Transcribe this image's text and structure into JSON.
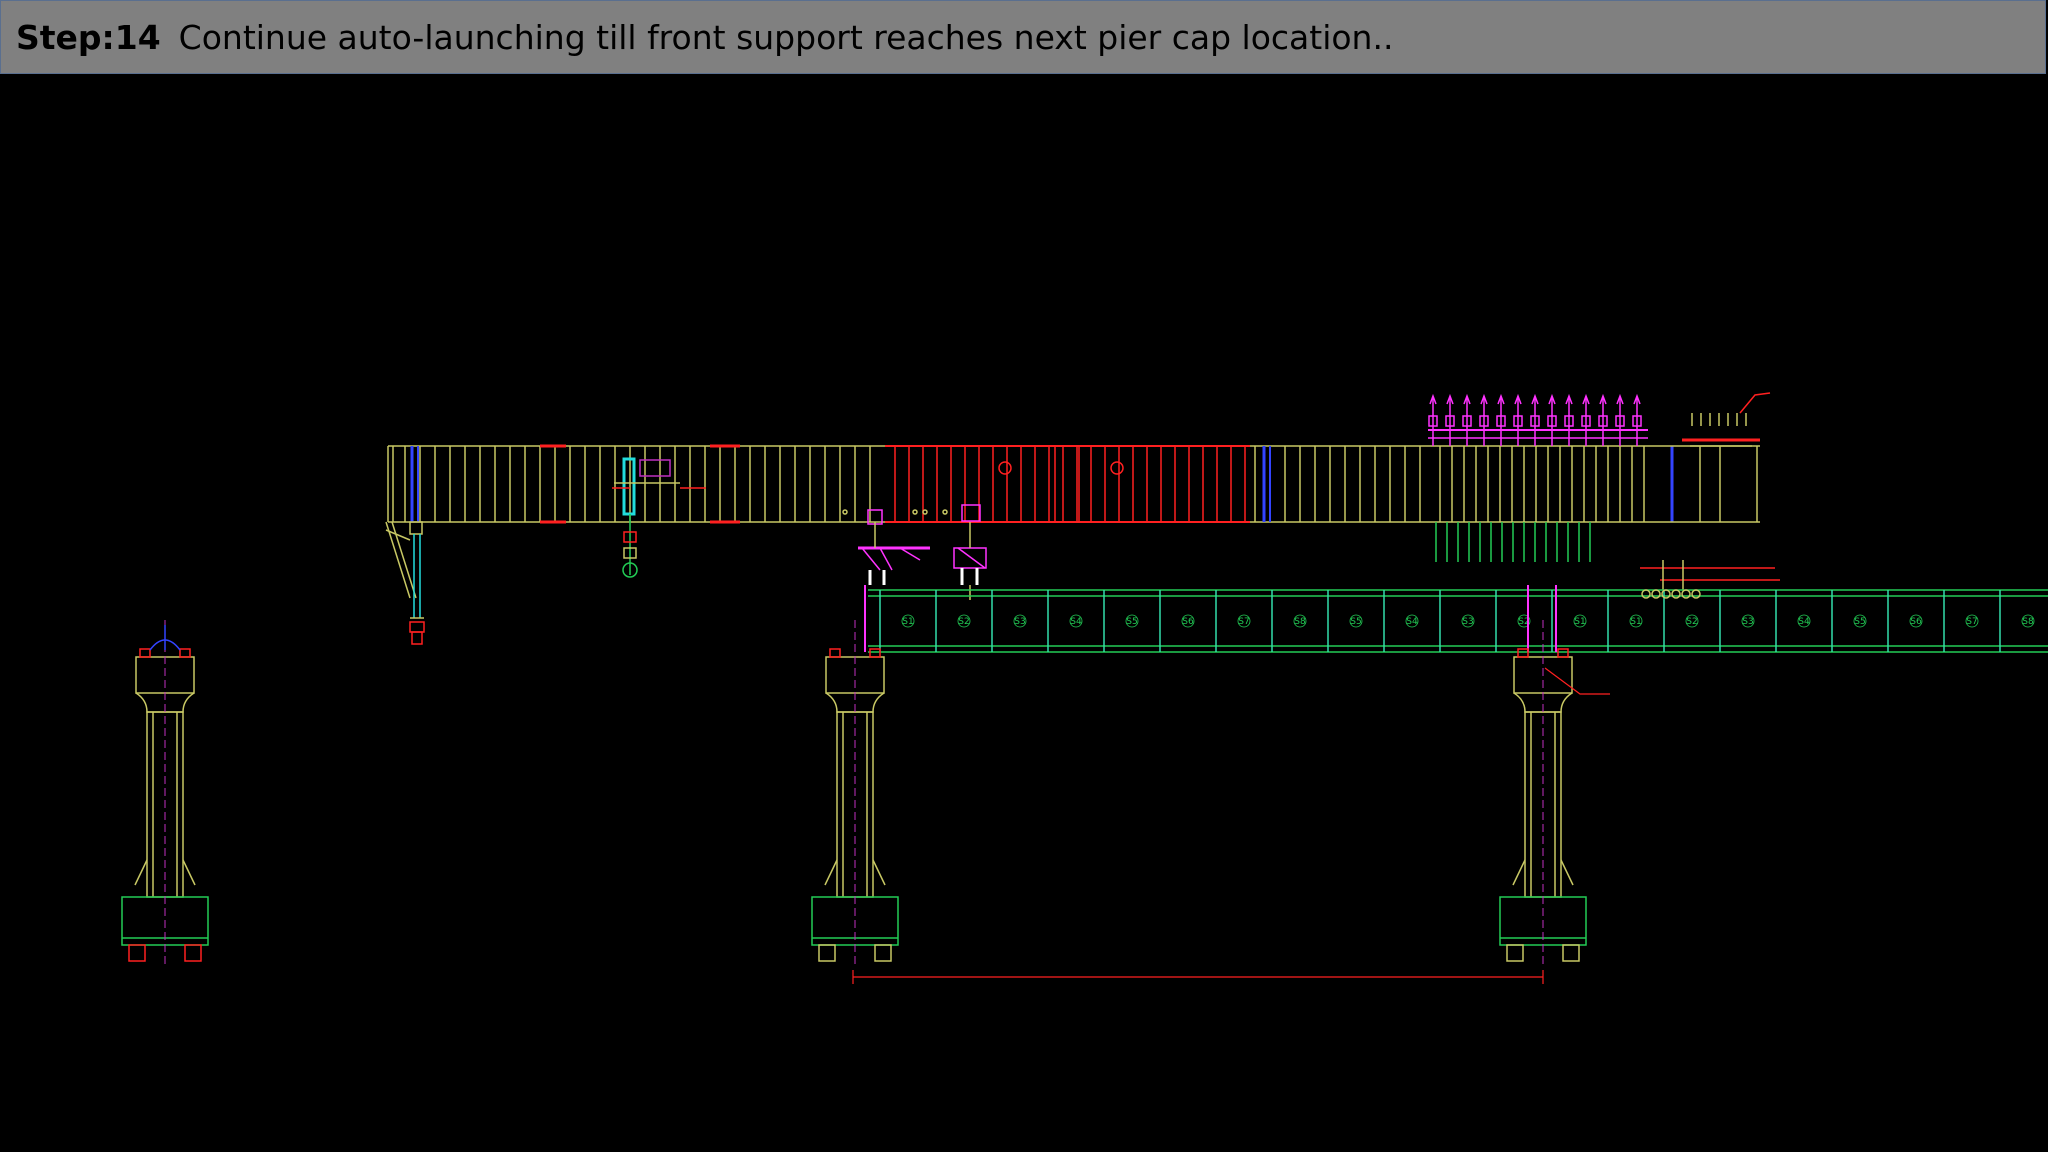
{
  "slide": {
    "step_label": "Step:14",
    "description": "Continue auto-launching till front support reaches next pier cap location.."
  },
  "drawing": {
    "segment_labels": [
      "S1",
      "S2",
      "S3",
      "S4",
      "S5",
      "S6",
      "S7",
      "S8",
      "S5",
      "S4",
      "S3",
      "S2",
      "S1",
      "S1",
      "S2",
      "S3",
      "S4",
      "S5",
      "S6",
      "S7",
      "S8",
      "S5"
    ],
    "colors": {
      "girder_main": "#c8c864",
      "girder_red": "#ff2020",
      "deck": "#22cc55",
      "deck_web": "#33ddaa",
      "pier": "#c8c864",
      "footing": "#22cc55",
      "centerline": "#c030c0",
      "magenta": "#ff33ff",
      "cyan": "#22dddd"
    }
  }
}
